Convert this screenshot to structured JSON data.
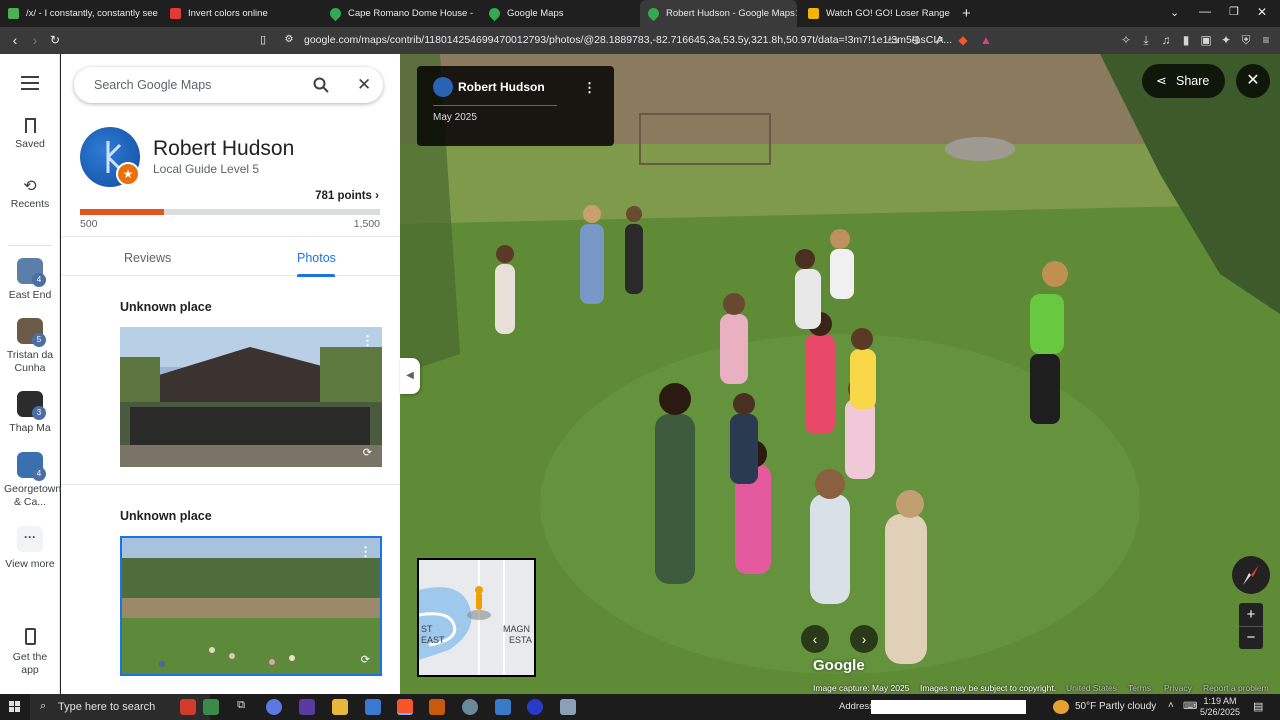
{
  "browser": {
    "tabs": [
      {
        "title": "/x/ - I constantly, constantly see the",
        "favicon_color": "#4caf50"
      },
      {
        "title": "Invert colors online",
        "favicon_color": "#e53935"
      },
      {
        "title": "Cape Romano Dome House - Goog",
        "favicon_color": "#34a853"
      },
      {
        "title": "Google Maps",
        "favicon_color": "#34a853"
      },
      {
        "title": "Robert Hudson - Google Maps",
        "favicon_color": "#34a853",
        "active": true
      },
      {
        "title": "Watch GO! GO! Loser Ranger! Seas",
        "favicon_color": "#f4b400"
      }
    ],
    "url": "google.com/maps/contrib/118014254699470012793/photos/@28.1889783,-82.716645,3a,53.5y,321.8h,50.97t/data=!3m7!1e1!3m5!1sCIA..."
  },
  "rail": {
    "menu_icon": "hamburger-icon",
    "items": [
      {
        "label": "Saved",
        "icon": "bookmark-icon"
      },
      {
        "label": "Recents",
        "icon": "history-icon"
      }
    ],
    "recent_places": [
      {
        "label": "East End",
        "count": "4",
        "color": "#5b7fa8"
      },
      {
        "label": "Tristan da Cunha",
        "count": "5",
        "color": "#6b5a48"
      },
      {
        "label": "Thap Ma",
        "count": "3",
        "color": "#2c2c2c"
      },
      {
        "label": "Georgetown & Ca...",
        "count": "4",
        "color": "#3a6fb0"
      }
    ],
    "view_more": "View more",
    "get_app": "Get the app"
  },
  "panel": {
    "search_placeholder": "Search Google Maps",
    "profile_name": "Robert Hudson",
    "profile_level": "Local Guide Level 5",
    "points": "781 points",
    "progress_min": "500",
    "progress_max": "1,500",
    "progress_fraction": 0.281,
    "tabs": {
      "reviews": "Reviews",
      "photos": "Photos"
    },
    "photos": [
      {
        "title": "Unknown place"
      },
      {
        "title": "Unknown place"
      }
    ]
  },
  "streetview": {
    "contributor": "Robert Hudson",
    "date": "May 2025",
    "share_label": "Share",
    "minimap_labels": [
      "ST",
      "EAST",
      "MAGN",
      "ESTA"
    ],
    "watermark": "Google",
    "footer": {
      "capture": "Image capture: May 2025",
      "copyright": "Images may be subject to copyright.",
      "country": "United States",
      "terms": "Terms",
      "privacy": "Privacy",
      "report": "Report a problem"
    }
  },
  "taskbar": {
    "search_placeholder": "Type here to search",
    "address_label": "Address",
    "weather": "50°F  Partly cloudy",
    "time": "1:19 AM",
    "date": "5/26/2025"
  }
}
